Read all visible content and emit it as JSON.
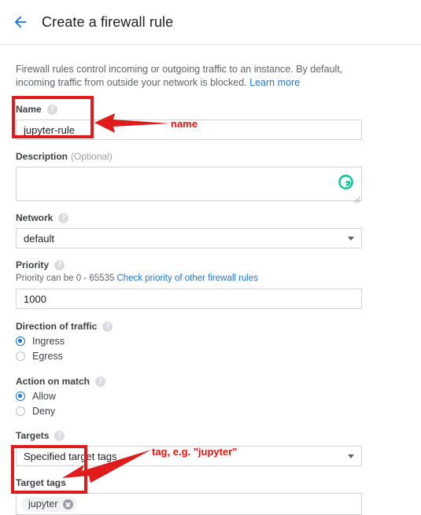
{
  "header": {
    "back_icon": "arrow-left-icon",
    "title": "Create a firewall rule"
  },
  "intro": {
    "text": "Firewall rules control incoming or outgoing traffic to an instance. By default, incoming traffic from outside your network is blocked.",
    "link_label": "Learn more"
  },
  "fields": {
    "name": {
      "label": "Name",
      "help_icon": "help-icon",
      "value": "jupyter-rule",
      "placeholder": ""
    },
    "description": {
      "label": "Description",
      "optional": "(Optional)",
      "value": "",
      "placeholder": "",
      "assistant_icon": "grammarly-icon",
      "resize_icon": "resize-handle-icon"
    },
    "network": {
      "label": "Network",
      "help_icon": "help-icon",
      "value": "default",
      "options": [
        "default"
      ],
      "caret_icon": "chevron-down-icon"
    },
    "priority": {
      "label": "Priority",
      "help_icon": "help-icon",
      "hint": "Priority can be 0 - 65535",
      "hint_link": "Check priority of other firewall rules",
      "value": "1000"
    },
    "direction": {
      "label": "Direction of traffic",
      "help_icon": "help-icon",
      "options": [
        {
          "label": "Ingress",
          "selected": true
        },
        {
          "label": "Egress",
          "selected": false
        }
      ]
    },
    "action": {
      "label": "Action on match",
      "help_icon": "help-icon",
      "options": [
        {
          "label": "Allow",
          "selected": true
        },
        {
          "label": "Deny",
          "selected": false
        }
      ]
    },
    "targets": {
      "label": "Targets",
      "help_icon": "help-icon",
      "value": "Specified target tags",
      "options": [
        "Specified target tags"
      ],
      "caret_icon": "chevron-down-icon"
    },
    "target_tags": {
      "label": "Target tags",
      "chips": [
        "jupyter"
      ],
      "chip_remove_icon": "close-circle-icon",
      "placeholder": ""
    }
  },
  "annotations": {
    "name_label": "name",
    "tag_label": "tag, e.g. \"jupyter\"",
    "color": "#e8130d"
  },
  "colors": {
    "accent_blue": "#1a73e8",
    "link_blue": "#1a73e8",
    "annotation_red": "#e8130d",
    "grammarly_teal": "#15c39a",
    "border_gray": "#d2d2d2"
  }
}
